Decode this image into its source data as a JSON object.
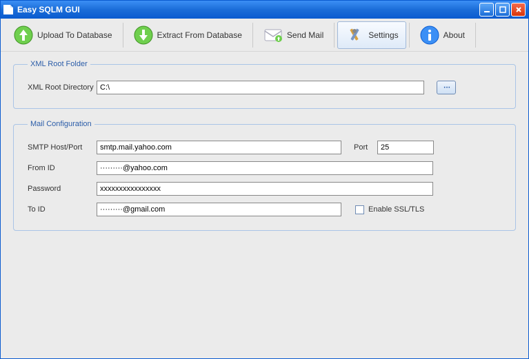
{
  "window": {
    "title": "Easy SQLM GUI"
  },
  "toolbar": {
    "upload": "Upload To Database",
    "extract": "Extract From Database",
    "sendmail": "Send Mail",
    "settings": "Settings",
    "about": "About"
  },
  "xmlroot": {
    "legend": "XML Root Folder",
    "label": "XML Root Directory",
    "value": "C:\\"
  },
  "mail": {
    "legend": "Mail Configuration",
    "smtp_label": "SMTP Host/Port",
    "smtp_value": "smtp.mail.yahoo.com",
    "port_label": "Port",
    "port_value": "25",
    "from_label": "From ID",
    "from_value": "·········@yahoo.com",
    "password_label": "Password",
    "password_value": "xxxxxxxxxxxxxxxx",
    "to_label": "To ID",
    "to_value": "·········@gmail.com",
    "ssl_label": "Enable SSL/TLS",
    "ssl_checked": false
  }
}
